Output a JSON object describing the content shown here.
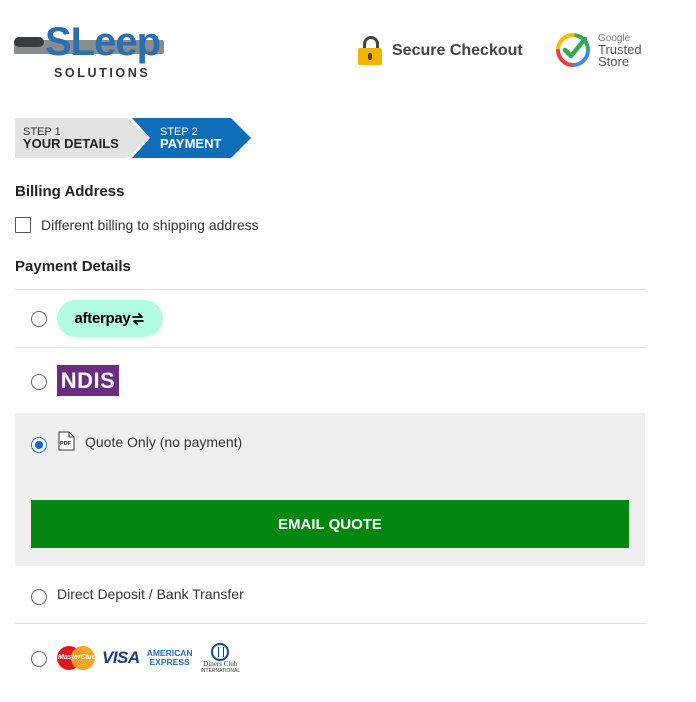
{
  "header": {
    "logo_word": "SLeep",
    "logo_sub": "SOLUTIONS",
    "secure_text": "Secure Checkout",
    "badge": {
      "line1": "Google",
      "line2": "Trusted",
      "line3": "Store"
    }
  },
  "steps": [
    {
      "small": "STEP 1",
      "big": "YOUR DETAILS",
      "active": false
    },
    {
      "small": "STEP 2",
      "big": "PAYMENT",
      "active": true
    }
  ],
  "billing": {
    "heading": "Billing Address",
    "checkbox_label": "Different billing to shipping address",
    "checked": false
  },
  "payment": {
    "heading": "Payment Details",
    "afterpay_label": "afterpay",
    "ndis_label": "NDIS",
    "quote_label": "Quote Only (no payment)",
    "email_button": "EMAIL QUOTE",
    "bank_label": "Direct Deposit / Bank Transfer",
    "selected": "quote",
    "cards": {
      "mastercard": "MasterCard",
      "visa": "VISA",
      "amex_line1": "AMERICAN",
      "amex_line2": "EXPRESS",
      "diners_line1": "Diners Club",
      "diners_line2": "INTERNATIONAL"
    }
  },
  "colors": {
    "brand_blue": "#2a6fb0",
    "step_active": "#0d6db6",
    "email_button": "#018610",
    "ndis": "#6a2c82",
    "afterpay": "#b2fce4"
  }
}
